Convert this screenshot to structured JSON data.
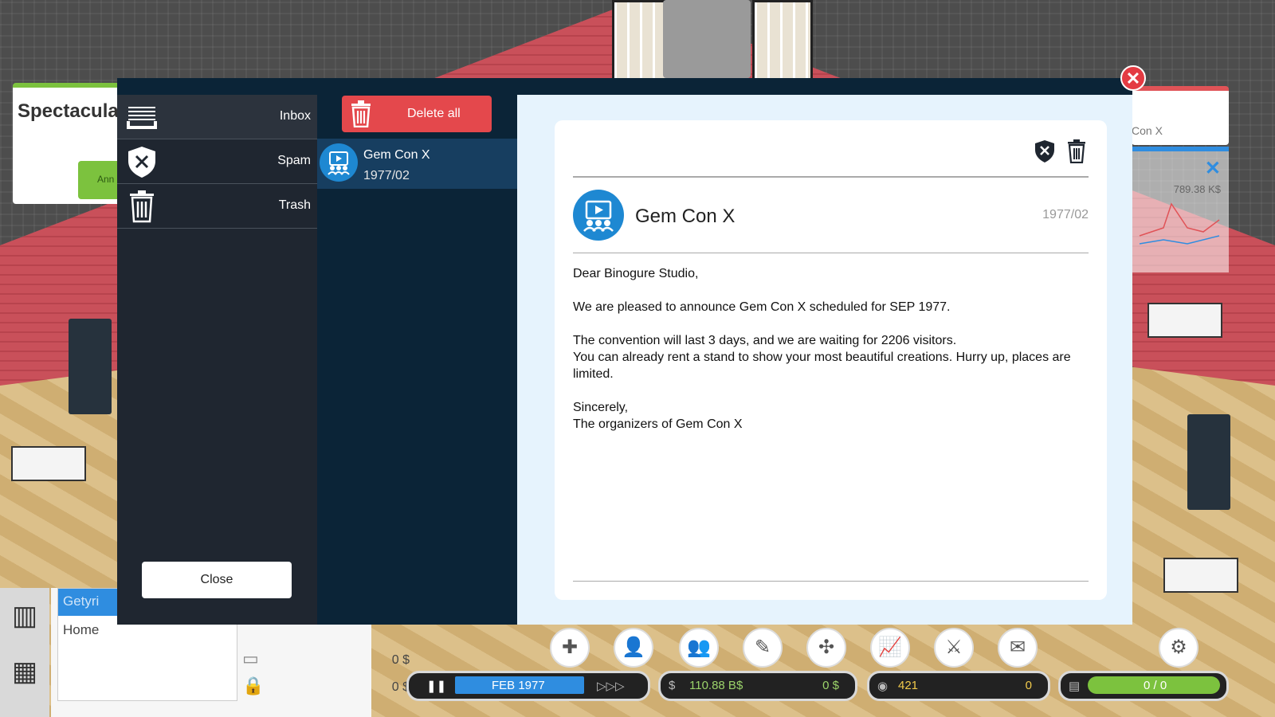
{
  "dialog": {
    "folders": [
      {
        "label": "Inbox",
        "icon": "inbox-icon"
      },
      {
        "label": "Spam",
        "icon": "spam-shield-icon"
      },
      {
        "label": "Trash",
        "icon": "trash-icon"
      }
    ],
    "close_label": "Close",
    "delete_all_label": "Delete all",
    "messages": [
      {
        "subject": "Gem Con X",
        "date": "1977/02",
        "icon": "convention-icon"
      }
    ],
    "reader": {
      "subject": "Gem Con X",
      "date": "1977/02",
      "body": {
        "greeting": "Dear Binogure Studio,",
        "p1": "We are pleased to announce Gem Con X scheduled for SEP 1977.",
        "p2a": "The convention will last 3 days, and we are waiting for 2206 visitors.",
        "p2b": "You can already rent a stand to show your most beautiful creations. Hurry up, places are limited.",
        "closing": "Sincerely,",
        "signature": "The organizers of Gem Con X"
      }
    }
  },
  "background": {
    "left_card_title": "Spectacula",
    "left_card_button": "Ann",
    "right_card_text": "Con X",
    "right_panel_value": "789.38 K$",
    "bottom_list": {
      "selected": "Getyri",
      "item": "Home"
    },
    "bottom_rows": [
      "0 $",
      "0 $"
    ],
    "status": {
      "date": "FEB 1977",
      "money": "110.88 B$",
      "money_delta": "0 $",
      "fans": "421",
      "fans_delta": "0",
      "progress": "0 / 0"
    }
  },
  "colors": {
    "dialog_bg": "#0b2437",
    "folders_bg": "#1f2630",
    "selected_message": "#173e60",
    "delete_button": "#e4484c",
    "reader_bg": "#e6f3fd",
    "close_x": "#e43b43"
  }
}
